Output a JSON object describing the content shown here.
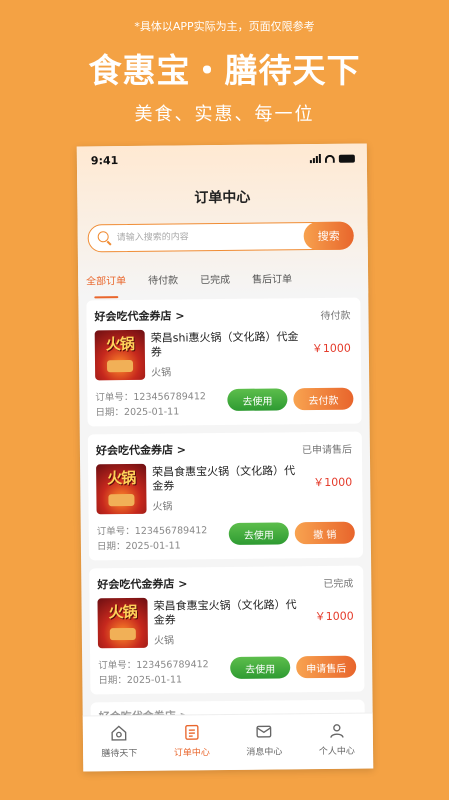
{
  "promo": {
    "note": "*具体以APP实际为主，页面仅限参考",
    "title": "食惠宝・膳待天下",
    "subtitle": "美食、实惠、每一位"
  },
  "status_bar": {
    "time": "9:41"
  },
  "header": {
    "title": "订单中心"
  },
  "search": {
    "placeholder": "请输入搜索的内容",
    "button_label": "搜索"
  },
  "tabs": [
    {
      "label": "全部订单",
      "active": true
    },
    {
      "label": "待付款"
    },
    {
      "label": "已完成"
    },
    {
      "label": "售后订单"
    }
  ],
  "orders": [
    {
      "store": "好会吃代金券店 >",
      "status": "待付款",
      "thumb_text": "火锅",
      "name": "荣昌shi惠火锅（文化路）代金券",
      "category": "火锅",
      "price": "￥1000",
      "order_no": "订单号：123456789412",
      "date": "日期：2025-01-11",
      "use_label": "去使用",
      "action_label": "去付款"
    },
    {
      "store": "好会吃代金券店 >",
      "status": "已申请售后",
      "thumb_text": "火锅",
      "name": "荣昌食惠宝火锅（文化路）代金券",
      "category": "火锅",
      "price": "￥1000",
      "order_no": "订单号：123456789412",
      "date": "日期：2025-01-11",
      "use_label": "去使用",
      "action_label": "撤 销"
    },
    {
      "store": "好会吃代金券店 >",
      "status": "已完成",
      "thumb_text": "火锅",
      "name": "荣昌食惠宝火锅（文化路）代金券",
      "category": "火锅",
      "price": "￥1000",
      "order_no": "订单号：123456789412",
      "date": "日期：2025-01-11",
      "use_label": "去使用",
      "action_label": "申请售后"
    }
  ],
  "peek_store": "好会吃代金券店 >",
  "bottom_nav": [
    {
      "label": "膳待天下",
      "icon": "home-icon"
    },
    {
      "label": "订单中心",
      "icon": "order-list-icon",
      "active": true
    },
    {
      "label": "消息中心",
      "icon": "message-icon"
    },
    {
      "label": "个人中心",
      "icon": "user-icon"
    }
  ],
  "colors": {
    "background": "#F4A244",
    "accent": "#E9662C",
    "use_button": "#2E9B32",
    "price": "#E43B2B"
  }
}
